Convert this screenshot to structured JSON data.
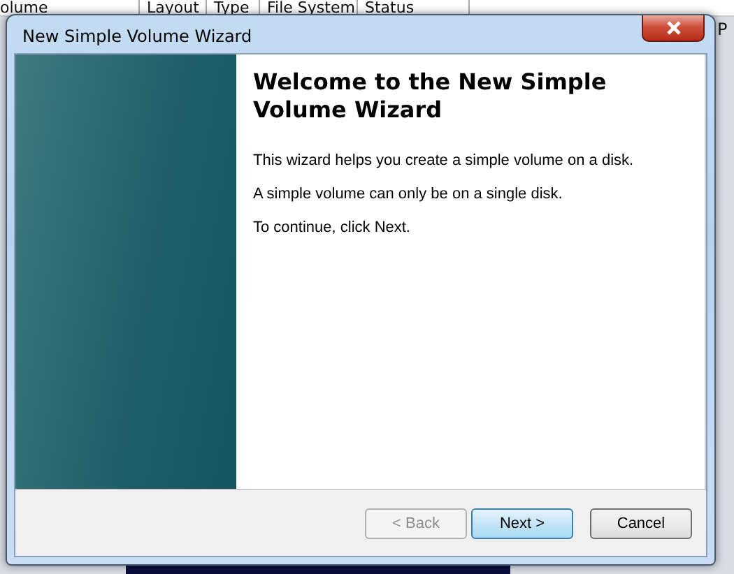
{
  "background_table": {
    "columns": [
      "olume",
      "Layout",
      "Type",
      "File System",
      "Status"
    ],
    "cell_text": "P"
  },
  "window": {
    "title": "New Simple Volume Wizard"
  },
  "heading": "Welcome to the New Simple Volume Wizard",
  "paragraphs": [
    "This wizard helps you create a simple volume on a disk.",
    "A simple volume can only be on a single disk.",
    "To continue, click Next."
  ],
  "buttons": [
    {
      "label": "< Back",
      "disabled": true,
      "default": false
    },
    {
      "label": "Next >",
      "disabled": false,
      "default": true
    },
    {
      "label": "Cancel",
      "disabled": false,
      "default": false
    }
  ]
}
